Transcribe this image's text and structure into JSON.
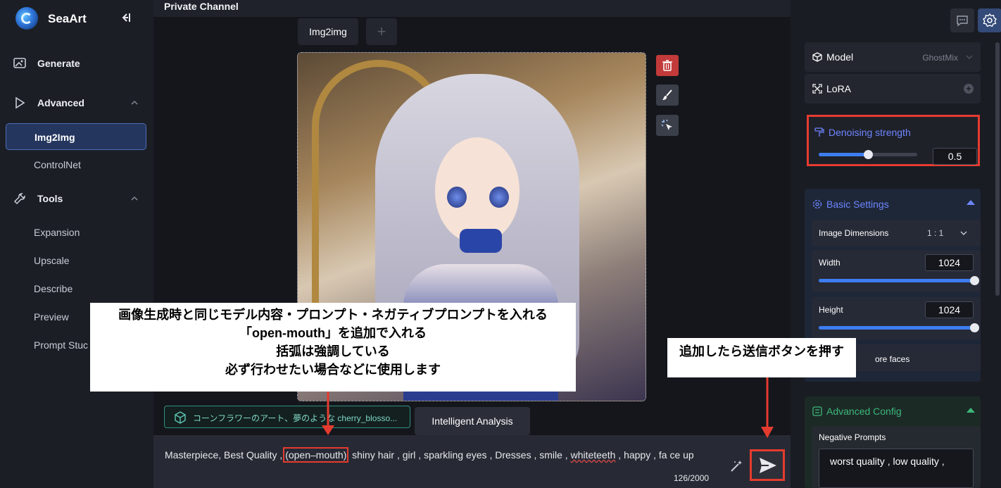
{
  "app": {
    "brand": "SeaArt"
  },
  "sidebar": {
    "generate": "Generate",
    "advanced": "Advanced",
    "advanced_items": [
      "Img2Img",
      "ControlNet"
    ],
    "tools": "Tools",
    "tools_items": [
      "Expansion",
      "Upscale",
      "Describe",
      "Preview",
      "Prompt Stuc"
    ]
  },
  "main": {
    "channel_title": "Private Channel",
    "tab_active": "Img2img",
    "tab_add": "+",
    "suggest_chip": "コーンフラワーのアート、夢のような cherry_blosso...",
    "analysis_button": "Intelligent Analysis",
    "prompt": {
      "part1": "Masterpiece, Best Quality , ",
      "highlight": "(open–mouth)",
      "part2": ", shiny hair , girl , sparkling eyes , Dresses , smile , ",
      "underlined": "whiteteeth",
      "part3": " , happy , fa ce up"
    },
    "counter": "126/2000"
  },
  "right_panel": {
    "model_label": "Model",
    "model_value": "GhostMix",
    "lora_label": "LoRA",
    "denoise_label": "Denoising strength",
    "denoise_value": "0.5",
    "denoise_level": 0.5,
    "basic_settings": "Basic Settings",
    "image_dimensions": "Image Dimensions",
    "ratio": "1 : 1",
    "width_label": "Width",
    "width_value": "1024",
    "height_label": "Height",
    "height_value": "1024",
    "restore_faces": "ore faces",
    "advanced_config": "Advanced Config",
    "negative_prompts": "Negative Prompts",
    "negative_value": "worst quality , low quality ,"
  },
  "annotations": {
    "main_lines": [
      "画像生成時と同じモデル内容・プロンプト・ネガティブプロンプトを入れる",
      "「open-mouth」を追加で入れる",
      "括弧は強調している",
      "必ず行わせたい場合などに使用します"
    ],
    "send_note": "追加したら送信ボタンを押す"
  },
  "colors": {
    "accent": "#3e7df0",
    "highlight_red": "#e53b2f",
    "section_blue": "#6d86ff",
    "section_green": "#3cb87a"
  }
}
